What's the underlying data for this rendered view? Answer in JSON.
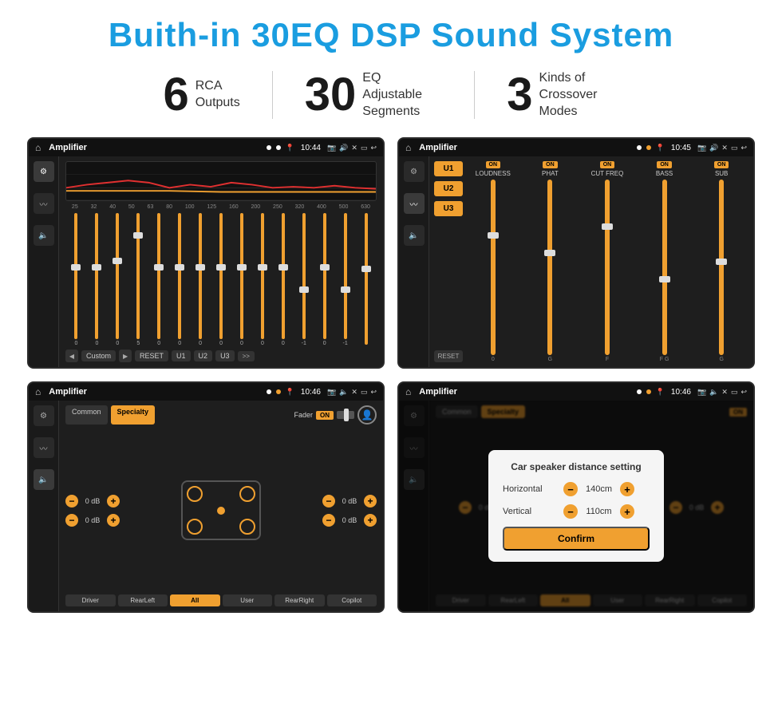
{
  "header": {
    "title": "Buith-in 30EQ DSP Sound System"
  },
  "stats": [
    {
      "number": "6",
      "label": "RCA\nOutputs"
    },
    {
      "number": "30",
      "label": "EQ Adjustable\nSegments"
    },
    {
      "number": "3",
      "label": "Kinds of\nCrossover Modes"
    }
  ],
  "screens": [
    {
      "id": "eq-screen",
      "app": "Amplifier",
      "time": "10:44",
      "label": "EQ Equalizer"
    },
    {
      "id": "crossover-screen",
      "app": "Amplifier",
      "time": "10:45",
      "label": "Crossover"
    },
    {
      "id": "fader-screen",
      "app": "Amplifier",
      "time": "10:46",
      "label": "Fader/Speaker"
    },
    {
      "id": "distance-screen",
      "app": "Amplifier",
      "time": "10:46",
      "label": "Distance Setting",
      "dialog": {
        "title": "Car speaker distance setting",
        "horizontal_label": "Horizontal",
        "horizontal_value": "140cm",
        "vertical_label": "Vertical",
        "vertical_value": "110cm",
        "confirm_label": "Confirm"
      }
    }
  ],
  "eq": {
    "freqs": [
      "25",
      "32",
      "40",
      "50",
      "63",
      "80",
      "100",
      "125",
      "160",
      "200",
      "250",
      "320",
      "400",
      "500",
      "630"
    ],
    "values": [
      "0",
      "0",
      "0",
      "5",
      "0",
      "0",
      "0",
      "0",
      "0",
      "0",
      "0",
      "-1",
      "0",
      "-1",
      ""
    ],
    "preset": "Custom",
    "buttons": [
      "RESET",
      "U1",
      "U2",
      "U3"
    ]
  },
  "crossover": {
    "channels": [
      "LOUDNESS",
      "PHAT",
      "CUT FREQ",
      "BASS",
      "SUB"
    ],
    "u_buttons": [
      "U1",
      "U2",
      "U3"
    ],
    "reset": "RESET"
  },
  "fader": {
    "tabs": [
      "Common",
      "Specialty"
    ],
    "active_tab": "Specialty",
    "fader_label": "Fader",
    "on_label": "ON",
    "db_values": [
      "0 dB",
      "0 dB",
      "0 dB",
      "0 dB"
    ],
    "bottom_btns": [
      "Driver",
      "RearLeft",
      "All",
      "User",
      "RearRight",
      "Copilot"
    ]
  },
  "distance_dialog": {
    "title": "Car speaker distance setting",
    "horizontal_label": "Horizontal",
    "horizontal_value": "140cm",
    "vertical_label": "Vertical",
    "vertical_value": "110cm",
    "confirm_label": "Confirm"
  }
}
